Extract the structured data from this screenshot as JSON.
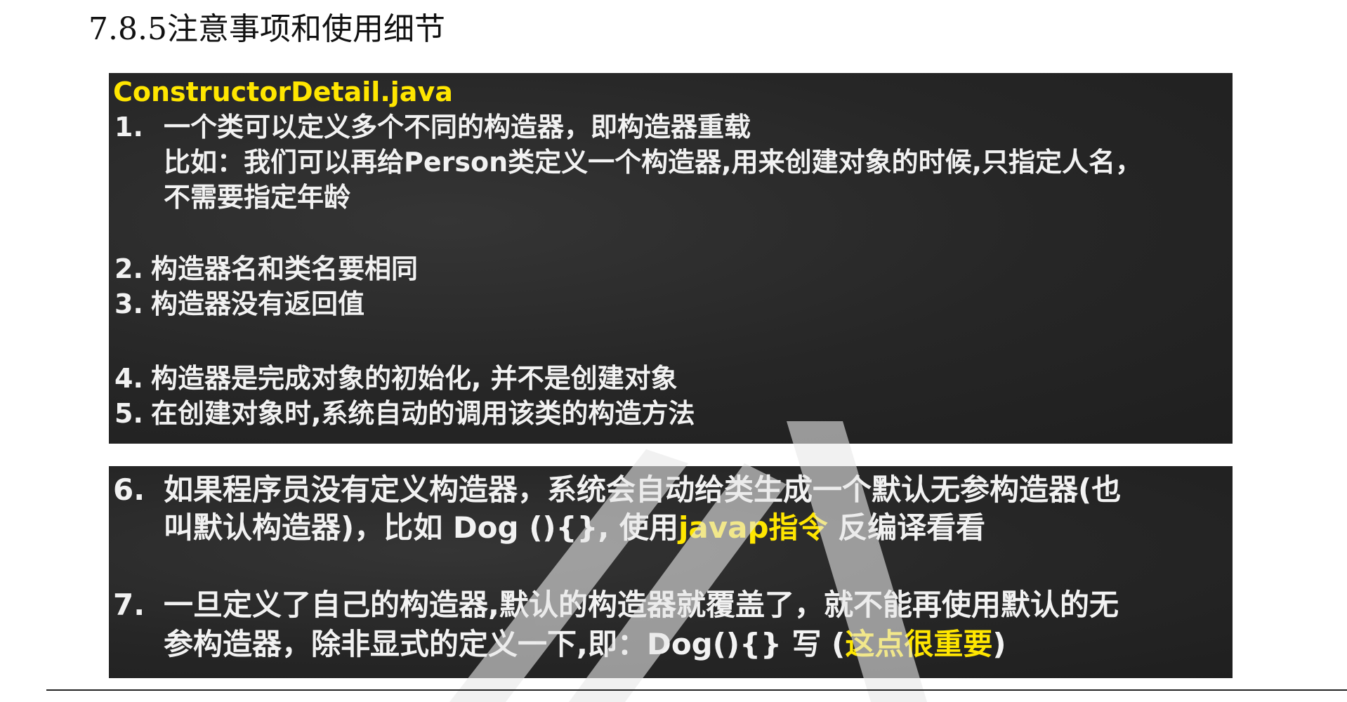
{
  "section": {
    "heading": "7.8.5注意事项和使用细节"
  },
  "panel1": {
    "title": "ConstructorDetail.java",
    "items": [
      {
        "num": "1.",
        "lines": [
          "一个类可以定义多个不同的构造器，即构造器重载",
          "比如：我们可以再给Person类定义一个构造器,用来创建对象的时候,只指定人名，",
          "不需要指定年龄"
        ]
      },
      {
        "num": "2.",
        "lines": [
          "构造器名和类名要相同"
        ]
      },
      {
        "num": "3.",
        "lines": [
          "构造器没有返回值"
        ]
      },
      {
        "num": "4.",
        "lines": [
          "构造器是完成对象的初始化, 并不是创建对象"
        ]
      },
      {
        "num": "5.",
        "lines": [
          "在创建对象时,系统自动的调用该类的构造方法"
        ]
      }
    ]
  },
  "panel2": {
    "item6": {
      "num": "6.",
      "line1": "如果程序员没有定义构造器，系统会自动给类生成一个默认无参构造器(也",
      "line2_pre": "叫默认构造器)，比如 Dog (){}, 使用",
      "line2_hl": "javap指令",
      "line2_post": " 反编译看看"
    },
    "item7": {
      "num": "7.",
      "line1": "一旦定义了自己的构造器,默认的构造器就覆盖了，就不能再使用默认的无",
      "line2_pre": "参构造器，除非显式的定义一下,即：Dog(){}  写 (",
      "line2_hl": "这点很重要",
      "line2_post": ")"
    }
  },
  "colors": {
    "board": "#2b2b2b",
    "highlight": "#ffe600",
    "text": "#f2f2f2"
  }
}
